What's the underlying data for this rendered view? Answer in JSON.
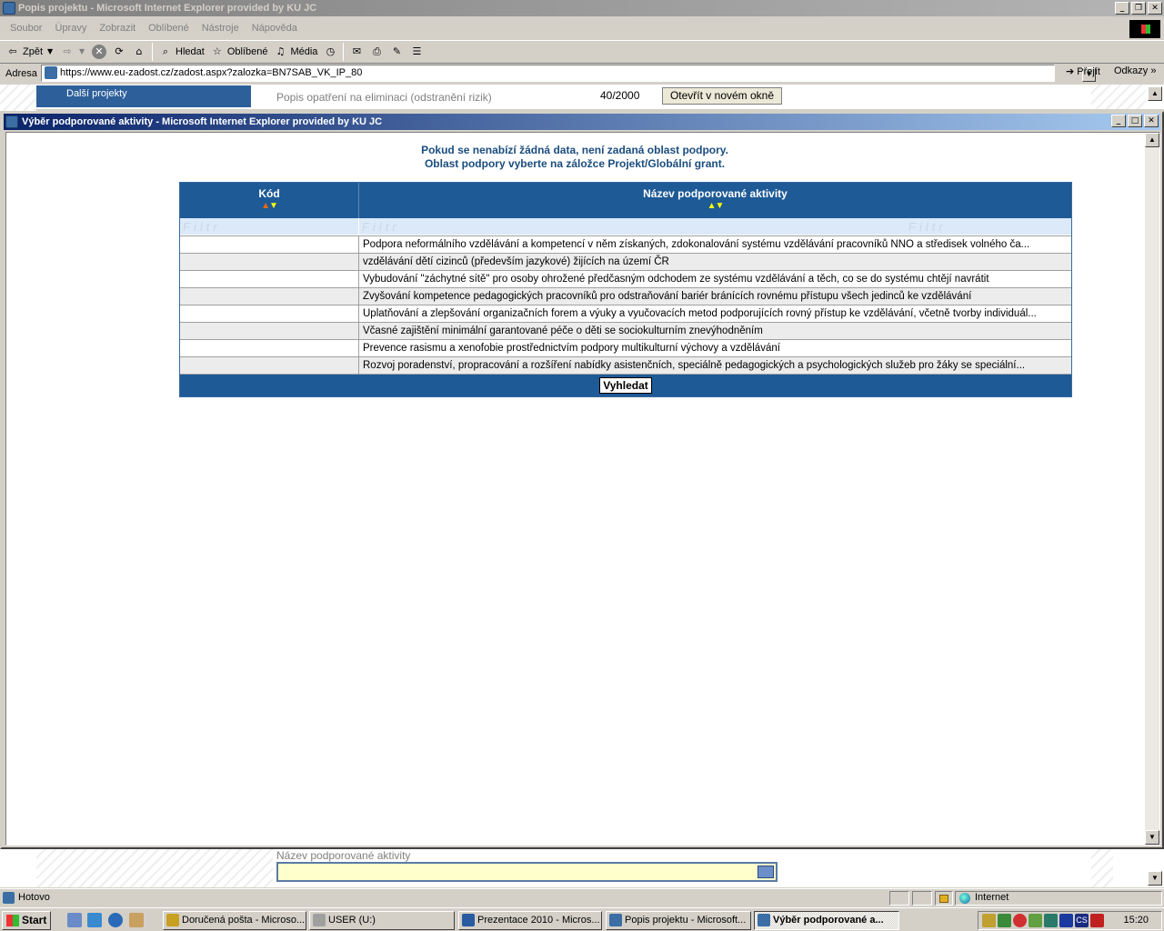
{
  "outer_window": {
    "title": "Popis projektu - Microsoft Internet Explorer provided by KU JC",
    "menu": [
      "Soubor",
      "Úpravy",
      "Zobrazit",
      "Oblíbené",
      "Nástroje",
      "Nápověda"
    ],
    "toolbar": {
      "back": "Zpět",
      "search": "Hledat",
      "favorites": "Oblíbené",
      "media": "Média"
    },
    "address_label": "Adresa",
    "address_url": "https://www.eu-zadost.cz/zadost.aspx?zalozka=BN7SAB_VK_IP_80",
    "go_label": "Přejít",
    "links_label": "Odkazy"
  },
  "background_page": {
    "sidebar_item": "Další projekty",
    "field_label": "Popis opatření na eliminaci (odstranění rizik)",
    "char_count": "40/2000",
    "open_button": "Otevřít v novém okně",
    "bottom_field_label": "Název podporované aktivity"
  },
  "popup": {
    "title": "Výběr podporované aktivity - Microsoft Internet Explorer provided by KU JC",
    "notice_line1": "Pokud se nenabízí žádná data, není zadaná oblast podpory.",
    "notice_line2": "Oblast podpory vyberte na záložce Projekt/Globální grant.",
    "grid": {
      "columns": [
        "Kód",
        "Název podporované aktivity"
      ],
      "filter_placeholder": "Filtr",
      "rows": [
        {
          "code": "",
          "name": "Podpora neformálního vzdělávání a kompetencí v něm získaných, zdokonalování systému vzdělávání pracovníků NNO a středisek volného ča..."
        },
        {
          "code": "",
          "name": "vzdělávání dětí cizinců (především jazykové) žijících na území ČR"
        },
        {
          "code": "",
          "name": "Vybudování \"záchytné sítě\" pro osoby ohrožené předčasným odchodem ze systému vzdělávání a těch, co se do systému chtějí navrátit"
        },
        {
          "code": "",
          "name": "Zvyšování kompetence pedagogických pracovníků pro odstraňování bariér bránících rovnému přístupu všech jedinců ke vzdělávání"
        },
        {
          "code": "",
          "name": "Uplatňování a zlepšování organizačních forem a výuky a vyučovacích metod podporujících rovný přístup ke vzdělávání, včetně tvorby individuál..."
        },
        {
          "code": "",
          "name": "Včasné zajištění minimální garantované péče o děti se sociokulturním znevýhodněním"
        },
        {
          "code": "",
          "name": "Prevence rasismu a xenofobie prostřednictvím podpory multikulturní výchovy a vzdělávání"
        },
        {
          "code": "",
          "name": "Rozvoj poradenství, propracování a rozšíření nabídky asistenčních, speciálně pedagogických a psychologických služeb pro žáky se speciální..."
        }
      ],
      "search_button": "Vyhledat"
    }
  },
  "statusbar": {
    "status": "Hotovo",
    "zone": "Internet"
  },
  "taskbar": {
    "start": "Start",
    "tasks": [
      {
        "label": "Doručená pošta - Microso..."
      },
      {
        "label": "USER (U:)"
      },
      {
        "label": "Prezentace 2010 - Micros..."
      },
      {
        "label": "Popis projektu - Microsoft..."
      },
      {
        "label": "Výběr podporované a..."
      }
    ],
    "clock": "15:20",
    "language": "CS"
  },
  "colors": {
    "grid_header": "#1e5a96",
    "title_active": "#0a246a",
    "sort_asc": "#ff6600",
    "sort_desc": "#ffff00"
  }
}
